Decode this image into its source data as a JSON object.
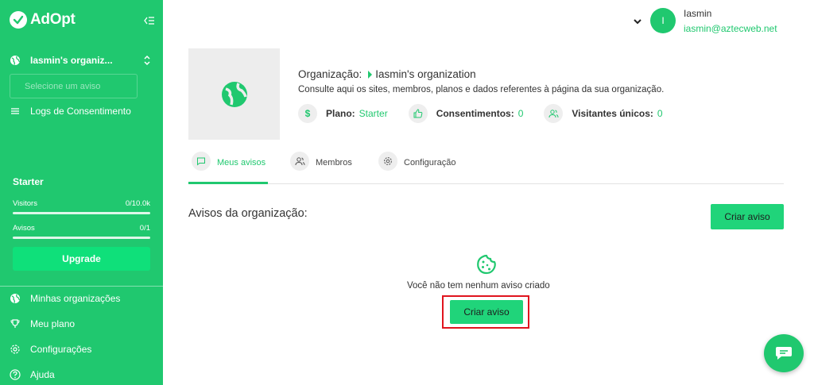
{
  "brand": {
    "name": "AdOpt"
  },
  "sidebar": {
    "org_name": "Iasmin's organiz...",
    "select_notice": "Selecione um aviso",
    "logs_label": "Logs de Consentimento",
    "plan_name": "Starter",
    "visitors_label": "Visitors",
    "visitors_value": "0/10.0k",
    "avisos_label": "Avisos",
    "avisos_value": "0/1",
    "upgrade_label": "Upgrade",
    "nav": [
      {
        "label": "Minhas organizações",
        "icon": "globe-icon"
      },
      {
        "label": "Meu plano",
        "icon": "trophy-icon"
      },
      {
        "label": "Configurações",
        "icon": "gear-icon"
      },
      {
        "label": "Ajuda",
        "icon": "help-icon"
      }
    ]
  },
  "user": {
    "initial": "I",
    "name": "Iasmin",
    "email": "iasmin@aztecweb.net"
  },
  "org": {
    "title_label": "Organização:",
    "name": "Iasmin's organization",
    "description": "Consulte aqui os sites, membros, planos e dados referentes à página da sua organização.",
    "stats": {
      "plan_label": "Plano:",
      "plan_value": "Starter",
      "consent_label": "Consentimentos:",
      "consent_value": "0",
      "visitors_label": "Visitantes únicos:",
      "visitors_value": "0"
    }
  },
  "tabs": [
    {
      "label": "Meus avisos",
      "active": true
    },
    {
      "label": "Membros",
      "active": false
    },
    {
      "label": "Configuração",
      "active": false
    }
  ],
  "main": {
    "section_title": "Avisos da organização:",
    "create_label": "Criar aviso",
    "empty_text": "Você não tem nenhum aviso criado",
    "empty_create_label": "Criar aviso"
  },
  "colors": {
    "brand_green": "#20c86f",
    "button_green": "#20d47a",
    "highlight_red": "#e0141e"
  }
}
